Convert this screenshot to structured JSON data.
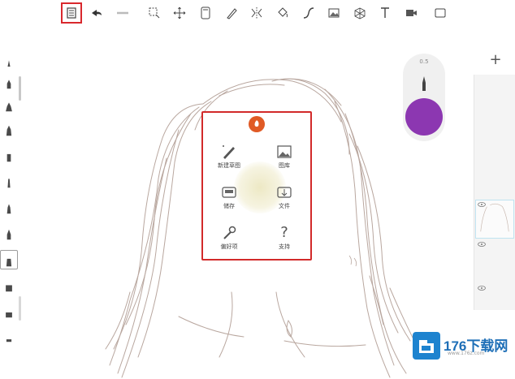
{
  "toolbar": {
    "items": [
      {
        "icon": "menu-list-icon"
      },
      {
        "icon": "undo-icon"
      },
      {
        "icon": "redo-icon"
      },
      {
        "icon": "select-icon"
      },
      {
        "icon": "transform-icon"
      },
      {
        "icon": "ruler-icon"
      },
      {
        "icon": "stroke-edit-icon"
      },
      {
        "icon": "symmetry-icon"
      },
      {
        "icon": "fill-icon"
      },
      {
        "icon": "curve-icon"
      },
      {
        "icon": "image-import-icon"
      },
      {
        "icon": "perspective-icon"
      },
      {
        "icon": "text-icon"
      },
      {
        "icon": "record-icon"
      },
      {
        "icon": "fullscreen-icon"
      }
    ]
  },
  "puck": {
    "brush_size": "0.5",
    "color": "#8c37b1"
  },
  "layers": {
    "add_label": "+"
  },
  "popup": {
    "new_sketch": "新建草图",
    "gallery": "图库",
    "save": "储存",
    "file": "文件",
    "preferences": "偏好项",
    "help": "支持",
    "help_glyph": "?"
  },
  "watermark": {
    "text": "176下载网",
    "sub": "www.176z.com"
  },
  "colors": {
    "accent_red": "#d22a2a",
    "brush_purple": "#8c37b1",
    "logo_orange": "#e05a25",
    "watermark_blue": "#1d83cf"
  }
}
